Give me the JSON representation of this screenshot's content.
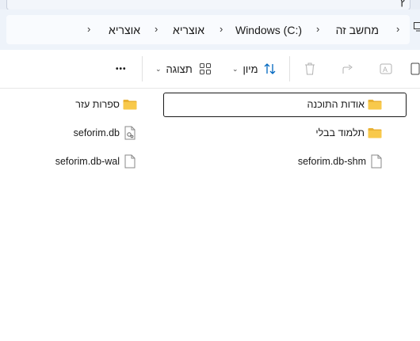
{
  "breadcrumb": {
    "items": [
      {
        "label": "מחשב זה"
      },
      {
        "label": "Windows (C:)"
      },
      {
        "label": "אוצריא"
      },
      {
        "label": "אוצריא"
      }
    ],
    "overflow_label": "›"
  },
  "toolbar": {
    "sort_label": "מיון",
    "view_label": "תצוגה",
    "more_label": "•••"
  },
  "files": [
    {
      "name": "אודות התוכנה",
      "kind": "folder"
    },
    {
      "name": "ספרות עזר",
      "kind": "folder"
    },
    {
      "name": "תלמוד בבלי",
      "kind": "folder"
    },
    {
      "name": "seforim.db",
      "kind": "db"
    },
    {
      "name": "seforim.db-shm",
      "kind": "file"
    },
    {
      "name": "seforim.db-wal",
      "kind": "file"
    }
  ],
  "icons": {
    "folder_color": "#f8c94b",
    "folder_dark": "#e9b132",
    "accent": "#0067c0"
  }
}
